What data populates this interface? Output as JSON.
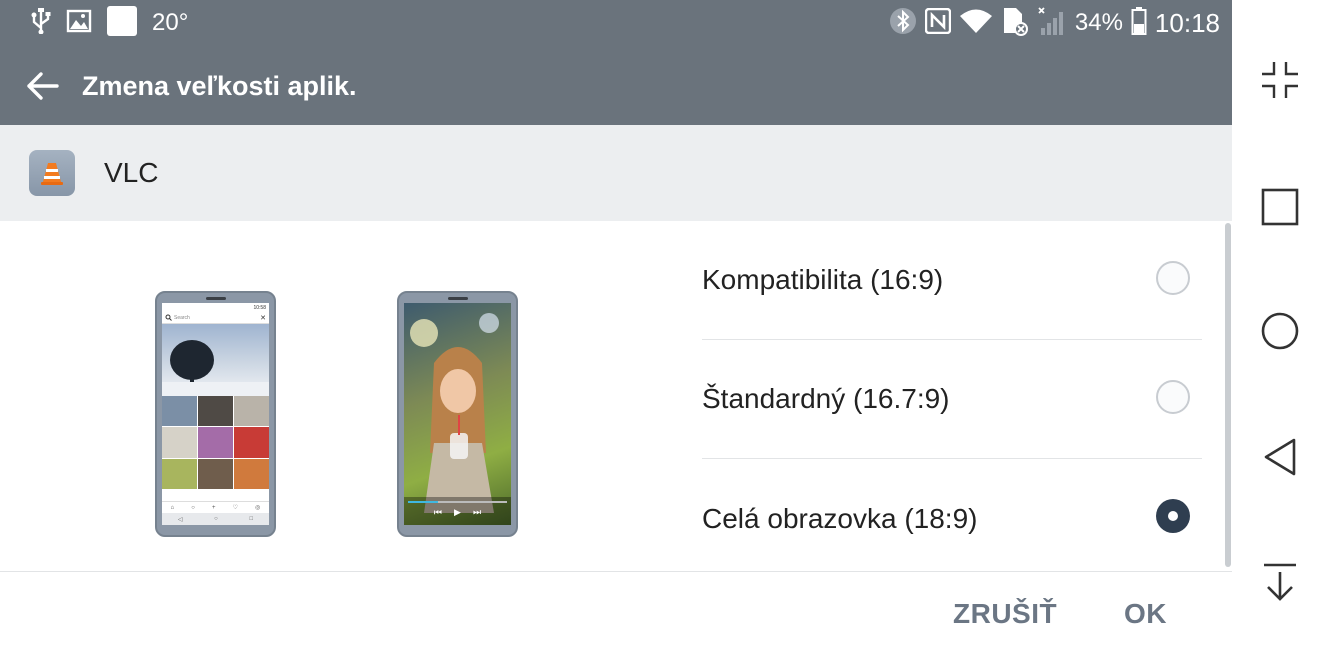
{
  "status_bar": {
    "temperature": "20°",
    "battery": "34%",
    "time": "10:18"
  },
  "app_bar": {
    "title": "Zmena veľkosti aplik."
  },
  "app": {
    "name": "VLC"
  },
  "options": [
    {
      "label": "Kompatibilita (16:9)",
      "selected": false
    },
    {
      "label": "Štandardný (16.7:9)",
      "selected": false
    },
    {
      "label": "Celá obrazovka (18:9)",
      "selected": true
    }
  ],
  "preview_search_placeholder": "Search",
  "preview_clock": "10:58",
  "actions": {
    "cancel": "ZRUŠIŤ",
    "ok": "OK"
  },
  "colors": {
    "app_bar": "#6a737c",
    "app_header": "#eceef0",
    "radio_selected": "#2f3e50",
    "action_text": "#6b7684"
  }
}
